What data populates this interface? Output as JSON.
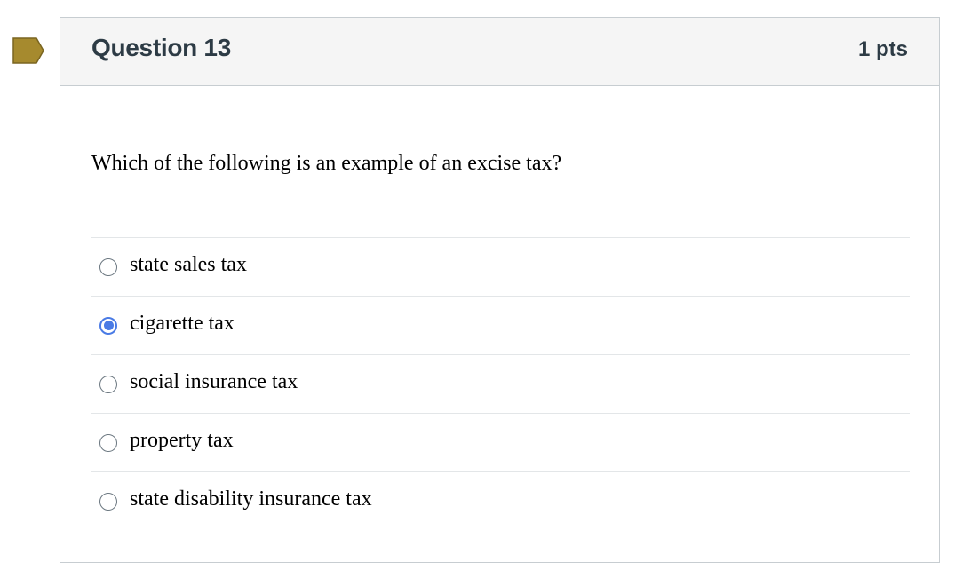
{
  "question": {
    "title": "Question 13",
    "points": "1 pts",
    "text": "Which of the following is an example of an excise tax?",
    "flag_color": "#a68a2e",
    "selected_color": "#4a7be5"
  },
  "answers": [
    {
      "label": "state sales tax",
      "selected": false
    },
    {
      "label": "cigarette tax",
      "selected": true
    },
    {
      "label": "social insurance tax",
      "selected": false
    },
    {
      "label": "property tax",
      "selected": false
    },
    {
      "label": "state disability insurance tax",
      "selected": false
    }
  ]
}
